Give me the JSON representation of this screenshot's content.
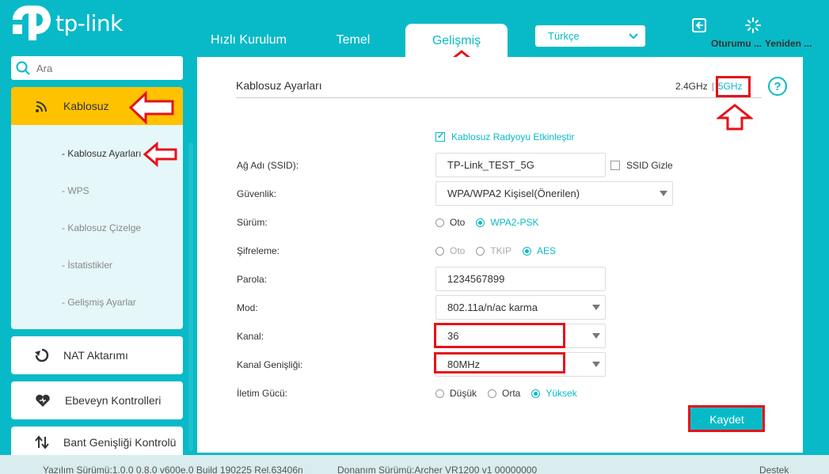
{
  "brand": {
    "logo_text": "tp-link"
  },
  "nav": {
    "tabs": [
      {
        "label": "Hızlı Kurulum"
      },
      {
        "label": "Temel"
      },
      {
        "label": "Gelişmiş"
      }
    ],
    "language": "Türkçe",
    "logout_label": "Oturumu ...",
    "reboot_label": "Yeniden ..."
  },
  "sidebar": {
    "search_placeholder": "Ara",
    "active": {
      "label": "Kablosuz",
      "icon": "wifi-icon"
    },
    "submenu": [
      {
        "label": "- Kablosuz Ayarları"
      },
      {
        "label": "- WPS"
      },
      {
        "label": "- Kablosuz Çizelge"
      },
      {
        "label": "- İstatistikler"
      },
      {
        "label": "- Gelişmiş Ayarlar"
      }
    ],
    "items": [
      {
        "label": "NAT Aktarımı",
        "icon": "nat-icon"
      },
      {
        "label": "Ebeveyn Kontrolleri",
        "icon": "heart-icon"
      },
      {
        "label": "Bant Genişliği Kontrolü",
        "icon": "bandwidth-icon"
      }
    ]
  },
  "content": {
    "title": "Kablosuz Ayarları",
    "band_24": "2.4GHz",
    "band_sep": "|",
    "band_5": "5GHz",
    "help": "?",
    "enable_radio_label": "Kablosuz Radyoyu Etkinleştir",
    "ssid_label": "Ağ Adı (SSID):",
    "ssid_value": "TP-Link_TEST_5G",
    "hide_ssid_label": "SSID Gizle",
    "security_label": "Güvenlik:",
    "security_value": "WPA/WPA2 Kişisel(Önerilen)",
    "version_label": "Sürüm:",
    "version_options": [
      "Oto",
      "WPA2-PSK"
    ],
    "encryption_label": "Şifreleme:",
    "encryption_options": [
      "Oto",
      "TKIP",
      "AES"
    ],
    "password_label": "Parola:",
    "password_value": "1234567899",
    "mode_label": "Mod:",
    "mode_value": "802.11a/n/ac karma",
    "channel_label": "Kanal:",
    "channel_value": "36",
    "width_label": "Kanal Genişliği:",
    "width_value": "80MHz",
    "power_label": "İletim Gücü:",
    "power_options": [
      "Düşük",
      "Orta",
      "Yüksek"
    ],
    "save_label": "Kaydet"
  },
  "footer": {
    "firmware": "Yazılım Sürümü:1.0.0 0.8.0 v600e.0 Build 190225 Rel.63406n",
    "hardware": "Donanım Sürümü:Archer VR1200 v1 00000000",
    "support": "Destek"
  },
  "colors": {
    "accent": "#08bac7",
    "active": "#ffc200",
    "annotation": "#e8111a"
  }
}
